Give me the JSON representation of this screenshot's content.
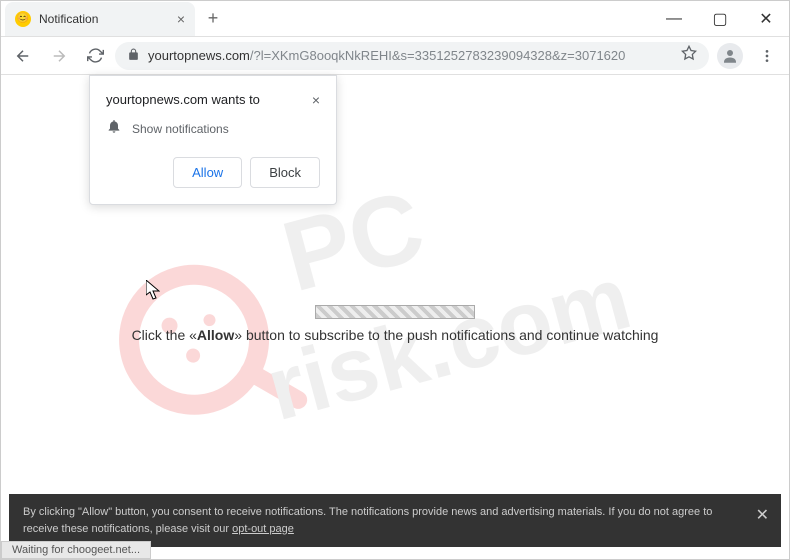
{
  "tab": {
    "title": "Notification",
    "favicon_glyph": "😊"
  },
  "window": {
    "minimize": "—",
    "maximize": "▢",
    "close": "✕"
  },
  "toolbar": {
    "url_domain": "yourtopnews.com",
    "url_path": "/?l=XKmG8ooqkNkREHI&s=3351252783239094328&z=3071620"
  },
  "permission": {
    "title": "yourtopnews.com wants to",
    "body": "Show notifications",
    "allow": "Allow",
    "block": "Block"
  },
  "main": {
    "text_before": "Click the «",
    "text_bold": "Allow",
    "text_after": "» button to subscribe to the push notifications and continue watching"
  },
  "cookie": {
    "text_a": "By clicking \"Allow\" button, you consent to receive notifications. The notifications provide news and advertising materials. If you do not agree to receive these notifications, please visit our ",
    "link": "opt-out page"
  },
  "status": "Waiting for choogeet.net..."
}
